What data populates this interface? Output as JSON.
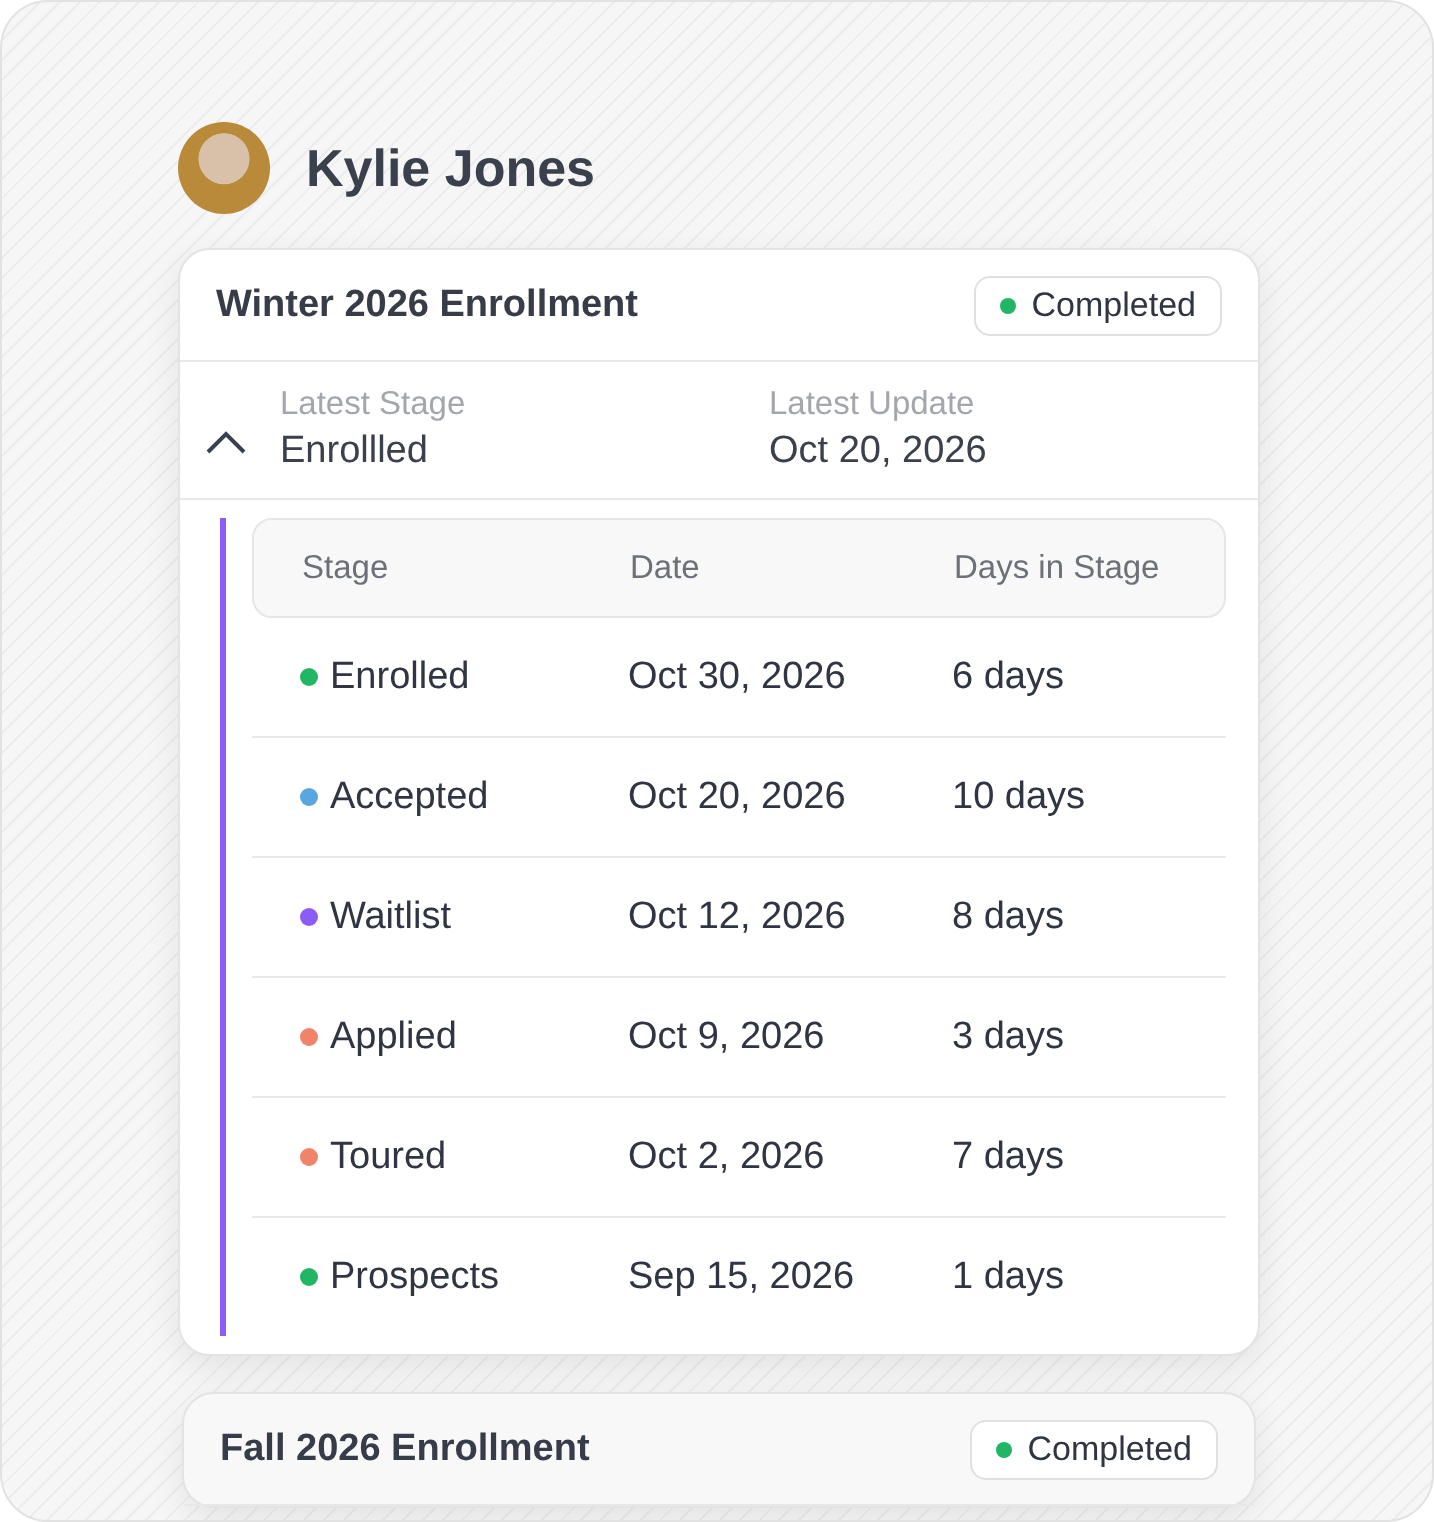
{
  "student": {
    "name": "Kylie Jones"
  },
  "enrollments": [
    {
      "title": "Winter 2026 Enrollment",
      "status": {
        "label": "Completed",
        "color": "#22b566"
      },
      "expanded": true,
      "summary": [
        {
          "label": "Latest Stage",
          "value": "Enrollled"
        },
        {
          "label": "Latest Update",
          "value": "Oct 20, 2026"
        }
      ],
      "table": {
        "columns": [
          "Stage",
          "Date",
          "Days in Stage"
        ],
        "rows": [
          {
            "stage": "Enrolled",
            "color": "#22b566",
            "date": "Oct 30, 2026",
            "days": "6 days"
          },
          {
            "stage": "Accepted",
            "color": "#5aa6e0",
            "date": "Oct 20, 2026",
            "days": "10 days"
          },
          {
            "stage": "Waitlist",
            "color": "#8b5cf6",
            "date": "Oct 12, 2026",
            "days": "8 days"
          },
          {
            "stage": "Applied",
            "color": "#f0836a",
            "date": "Oct 9, 2026",
            "days": "3 days"
          },
          {
            "stage": "Toured",
            "color": "#f0836a",
            "date": "Oct 2, 2026",
            "days": "7 days"
          },
          {
            "stage": "Prospects",
            "color": "#22b566",
            "date": "Sep 15, 2026",
            "days": "1 days"
          }
        ]
      }
    },
    {
      "title": "Fall 2026 Enrollment",
      "status": {
        "label": "Completed",
        "color": "#22b566"
      }
    }
  ]
}
